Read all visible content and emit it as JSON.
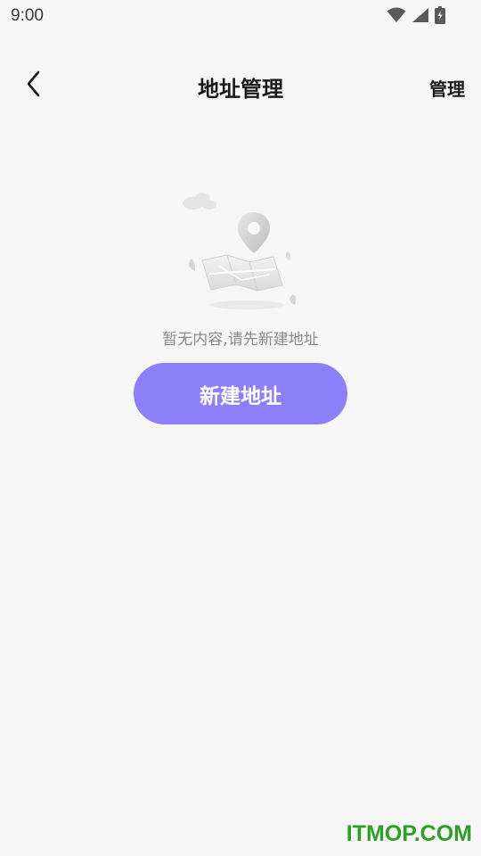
{
  "status_bar": {
    "time": "9:00",
    "icons": [
      "wifi-icon",
      "signal-icon",
      "battery-charging-icon"
    ]
  },
  "header": {
    "back_icon": "chevron-left-icon",
    "title": "地址管理",
    "action_label": "管理"
  },
  "empty_state": {
    "illustration": "map-location-pin-illustration",
    "message": "暂无内容,请先新建地址",
    "button_label": "新建地址"
  },
  "colors": {
    "background": "#f6f6f6",
    "primary_button": "#8d7ff7",
    "watermark": "#2aa024"
  },
  "watermark": "ITMOP.COM"
}
